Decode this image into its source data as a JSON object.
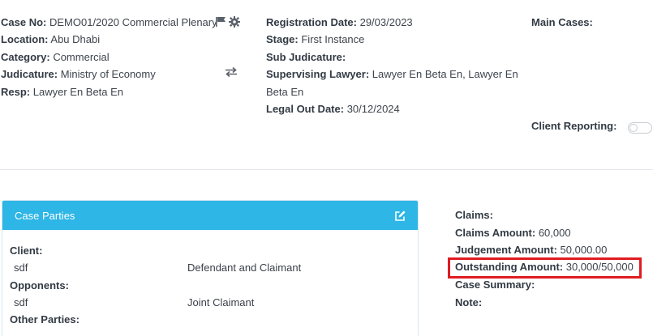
{
  "col1": {
    "case_no_label": "Case No:",
    "case_no_value": "DEMO01/2020 Commercial Plenary",
    "location_label": "Location:",
    "location_value": "Abu Dhabi",
    "category_label": "Category:",
    "category_value": "Commercial",
    "judicature_label": "Judicature:",
    "judicature_value": "Ministry of Economy",
    "resp_label": "Resp:",
    "resp_value": "Lawyer En Beta En"
  },
  "col2": {
    "registration_label": "Registration Date:",
    "registration_value": "29/03/2023",
    "stage_label": "Stage:",
    "stage_value": "First Instance",
    "sub_judicature_label": "Sub Judicature:",
    "supervising_label": "Supervising Lawyer:",
    "supervising_value_line1": "Lawyer En Beta En, Lawyer En",
    "supervising_value_line2": "Beta En",
    "legal_out_label": "Legal Out Date:",
    "legal_out_value": "30/12/2024"
  },
  "col3": {
    "main_cases_label": "Main Cases:",
    "client_reporting_label": "Client Reporting:",
    "client_reporting_on": false
  },
  "parties": {
    "title": "Case Parties",
    "client_label": "Client:",
    "client_name": "sdf",
    "client_role": "Defendant and Claimant",
    "opponents_label": "Opponents:",
    "opponent_name": "sdf",
    "opponent_role": "Joint Claimant",
    "other_label": "Other Parties:"
  },
  "claims": {
    "claims_label": "Claims:",
    "claims_amount_label": "Claims Amount:",
    "claims_amount_value": "60,000",
    "judgement_label": "Judgement Amount:",
    "judgement_value": "50,000.00",
    "outstanding_label": "Outstanding Amount:",
    "outstanding_value": "30,000/50,000",
    "summary_label": "Case Summary:",
    "note_label": "Note:"
  },
  "colors": {
    "panel_header": "#2db6e6",
    "highlight": "#e01b22"
  },
  "icons": [
    "flag-icon",
    "gear-icon",
    "swap-arrows-icon",
    "edit-icon"
  ]
}
